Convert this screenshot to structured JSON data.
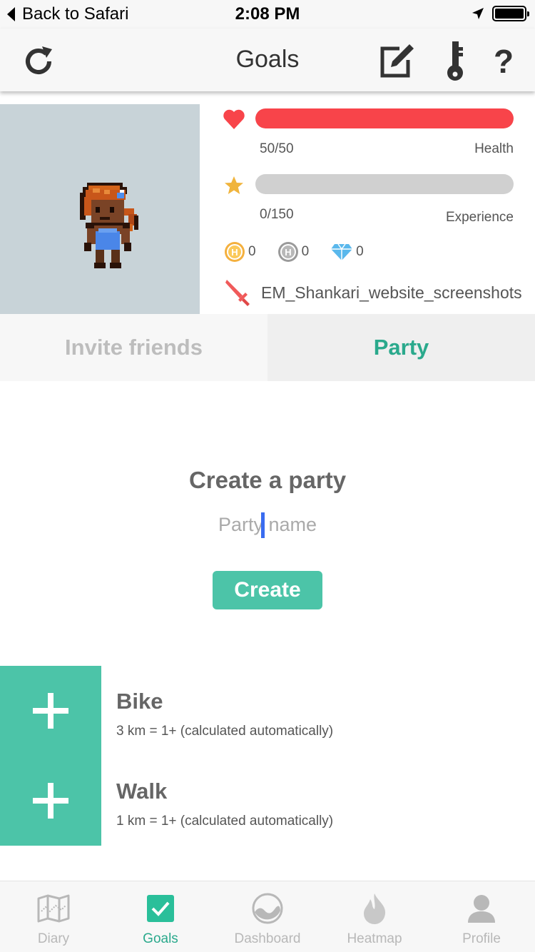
{
  "status_bar": {
    "back_label": "Back to Safari",
    "time": "2:08 PM"
  },
  "nav": {
    "title": "Goals",
    "icons": [
      "refresh-icon",
      "edit-icon",
      "key-icon",
      "help-icon"
    ],
    "help_glyph": "?"
  },
  "profile": {
    "health": {
      "value": "50/50",
      "label": "Health",
      "fraction": 1.0,
      "color": "#f8444a"
    },
    "experience": {
      "value": "0/150",
      "label": "Experience",
      "fraction": 0.0,
      "color": "#f0b43c"
    },
    "currency": {
      "gold": "0",
      "silver": "0",
      "gems": "0"
    },
    "username": "EM_Shankari_website_screenshots"
  },
  "tabs": {
    "invite_label": "Invite friends",
    "party_label": "Party",
    "active": "party"
  },
  "create_party": {
    "title": "Create a party",
    "input_placeholder": "Party name",
    "input_value": "",
    "button_label": "Create"
  },
  "goals": [
    {
      "name": "Bike",
      "description": "3 km = 1+ (calculated automatically)"
    },
    {
      "name": "Walk",
      "description": "1 km = 1+ (calculated automatically)"
    }
  ],
  "tabbar": {
    "items": [
      {
        "label": "Diary",
        "icon": "map-icon"
      },
      {
        "label": "Goals",
        "icon": "checkbox-icon"
      },
      {
        "label": "Dashboard",
        "icon": "dashboard-icon"
      },
      {
        "label": "Heatmap",
        "icon": "flame-icon"
      },
      {
        "label": "Profile",
        "icon": "person-icon"
      }
    ],
    "active": "Goals"
  },
  "colors": {
    "accent": "#4cc4a8",
    "accent_text": "#2aa98c",
    "health": "#f8444a",
    "star": "#f0b43c",
    "caret": "#3a6cf0"
  }
}
